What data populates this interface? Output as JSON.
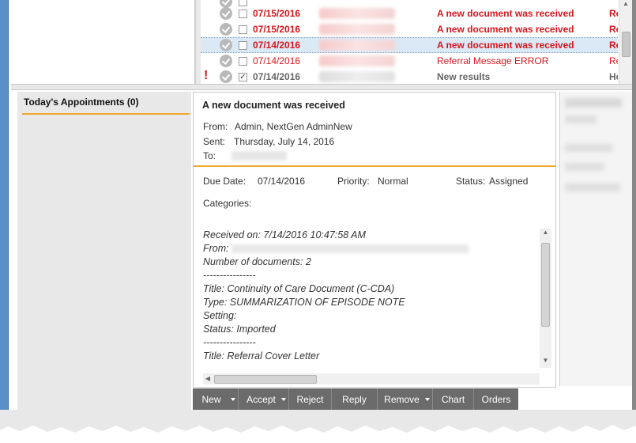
{
  "message_list": {
    "rows": [
      {
        "date": "07/15/2016",
        "subject": "A new document was received",
        "trail": "Rece",
        "style": "bold-red",
        "checked": false
      },
      {
        "date": "07/15/2016",
        "subject": "A new document was received",
        "trail": "Rece",
        "style": "bold-red",
        "checked": false
      },
      {
        "date": "07/14/2016",
        "subject": "A new document was received",
        "trail": "Rec",
        "style": "bold-red",
        "checked": false
      },
      {
        "date": "07/14/2016",
        "subject": "Referral Message ERROR",
        "trail": "Re",
        "style": "red",
        "checked": false
      },
      {
        "date": "07/14/2016",
        "subject": "New results",
        "trail": "Hel",
        "style": "gray-b",
        "checked": true
      }
    ]
  },
  "appointments": {
    "title": "Today's Appointments (0)"
  },
  "reader": {
    "subject": "A new document was received",
    "from_label": "From:",
    "from_value": "Admin, NextGen AdminNew",
    "sent_label": "Sent:",
    "sent_value": "Thursday, July 14, 2016",
    "to_label": "To:",
    "due_label": "Due Date:",
    "due_value": "07/14/2016",
    "priority_label": "Priority:",
    "priority_value": "Normal",
    "status_label": "Status:",
    "status_value": "Assigned",
    "categories_label": "Categories:",
    "body": {
      "received": "Received on: 7/14/2016 10:47:58 AM",
      "from": "From:",
      "num_docs": "Number of documents: 2",
      "sep1": "----------------",
      "title1": "Title: Continuity of Care Document (C-CDA)",
      "type1": "Type: SUMMARIZATION OF EPISODE NOTE",
      "setting": "Setting:",
      "status": "Status: Imported",
      "sep2": "----------------",
      "title2": "Title: Referral Cover Letter"
    }
  },
  "toolbar": {
    "new": "New",
    "accept": "Accept",
    "reject": "Reject",
    "reply": "Reply",
    "remove": "Remove",
    "chart": "Chart",
    "orders": "Orders"
  },
  "icons": {
    "status": "check-circle-icon",
    "flag": "exclamation-icon"
  },
  "colors": {
    "unread_red": "#d4161c",
    "accent_orange": "#f0a830",
    "toolbar_gray": "#6b6b6b",
    "selection_blue": "#dbe9f6"
  }
}
